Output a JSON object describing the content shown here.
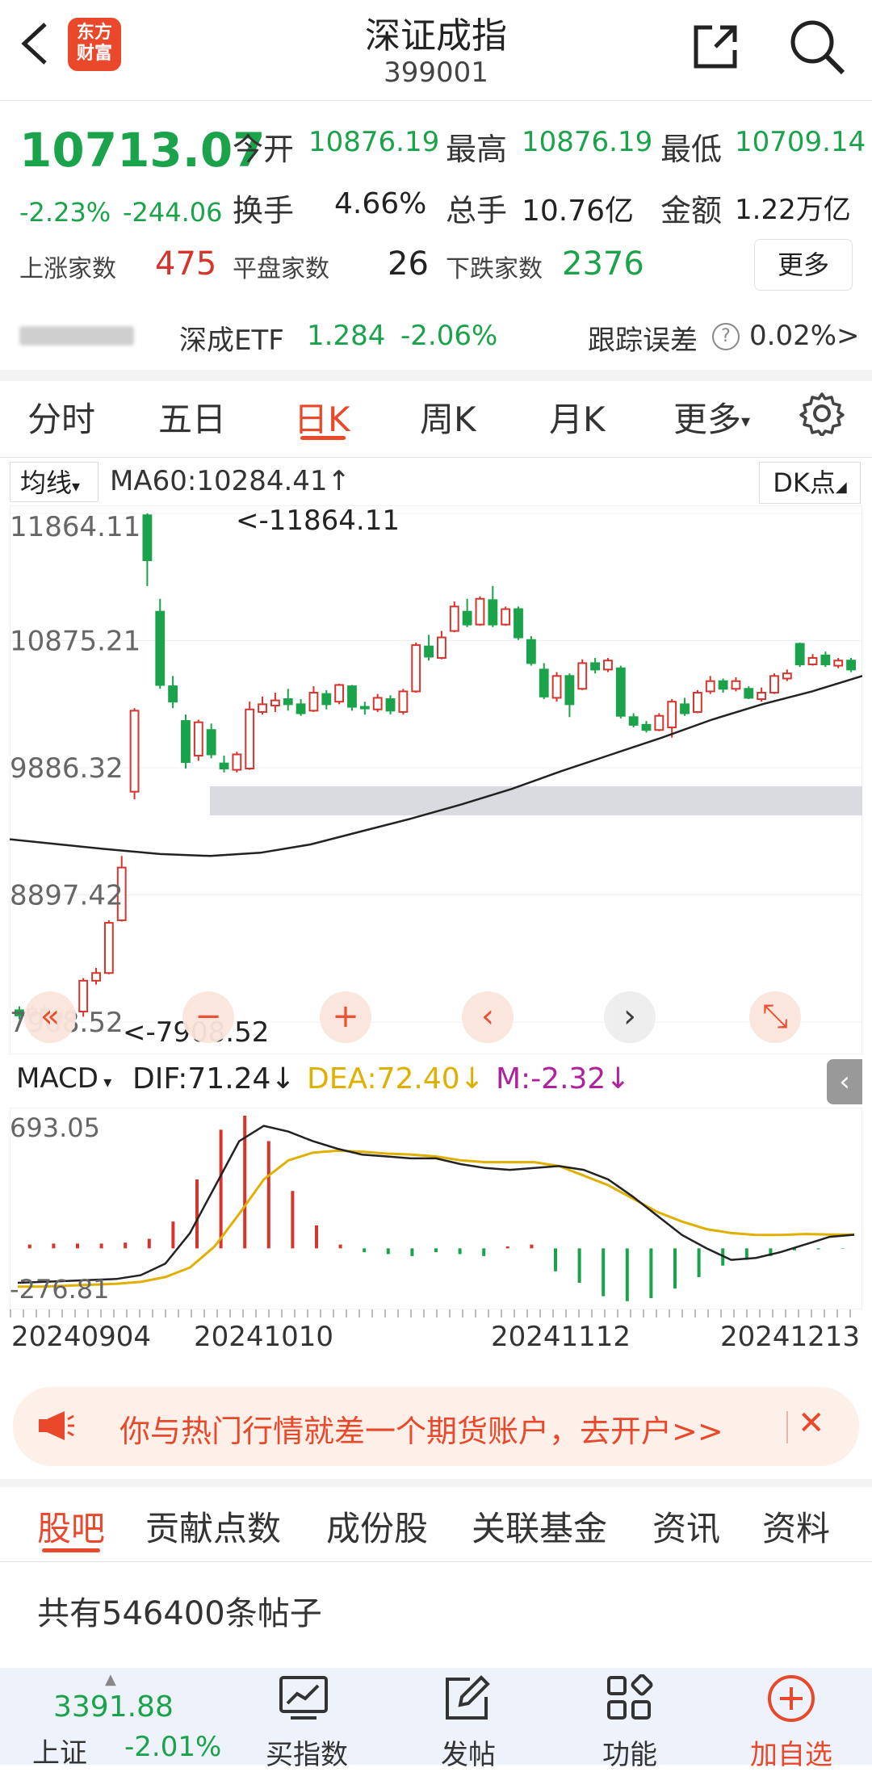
{
  "header": {
    "logo_line1": "东方",
    "logo_line2": "财富",
    "title": "深证成指",
    "code": "399001"
  },
  "quote": {
    "price": "10713.07",
    "change_pct": "-2.23%",
    "change": "-244.06",
    "open_label": "今开",
    "open": "10876.19",
    "high_label": "最高",
    "high": "10876.19",
    "low_label": "最低",
    "low": "10709.14",
    "turnover_label": "换手",
    "turnover": "4.66%",
    "volume_label": "总手",
    "volume": "10.76亿",
    "amount_label": "金额",
    "amount": "1.22万亿",
    "up_label": "上涨家数",
    "up_count": "475",
    "flat_label": "平盘家数",
    "flat_count": "26",
    "down_label": "下跌家数",
    "down_count": "2376",
    "more_label": "更多"
  },
  "etf": {
    "name": "深成ETF",
    "price": "1.284",
    "change": "-2.06%",
    "tracking_label": "跟踪误差",
    "tracking_value": "0.02%",
    "arrow": ">"
  },
  "tabs": [
    "分时",
    "五日",
    "日K",
    "周K",
    "月K",
    "更多"
  ],
  "active_tab": "日K",
  "chart_bar": {
    "ma_selector": "均线",
    "ma_text": "MA60:10284.41",
    "ma_arrow": "↑",
    "dk_label": "DK点"
  },
  "chart_data": {
    "type": "candlestick",
    "y_ticks": [
      "11864.11",
      "10875.21",
      "9886.32",
      "8897.42",
      "7908.52"
    ],
    "max_label": "<-11864.11",
    "min_label": "<-7908.52",
    "ylim": [
      7908.52,
      11864.11
    ],
    "x_ticks": [
      "20240904",
      "20241010",
      "20241112",
      "20241213"
    ],
    "ma60": [
      9330,
      9290,
      9250,
      9215,
      9200,
      9225,
      9290,
      9390,
      9490,
      9600,
      9720,
      9860,
      9990,
      10120,
      10260,
      10380,
      10480,
      10600
    ],
    "candles": [
      {
        "o": 8000,
        "c": 7960,
        "h": 8030,
        "l": 7930
      },
      {
        "o": 7960,
        "c": 8010,
        "h": 8040,
        "l": 7940
      },
      {
        "o": 8010,
        "c": 7975,
        "h": 8040,
        "l": 7950
      },
      {
        "o": 7975,
        "c": 7940,
        "h": 7990,
        "l": 7915
      },
      {
        "o": 7940,
        "c": 7990,
        "h": 8010,
        "l": 7920
      },
      {
        "o": 7990,
        "c": 8230,
        "h": 8250,
        "l": 7950
      },
      {
        "o": 8230,
        "c": 8290,
        "h": 8330,
        "l": 8200
      },
      {
        "o": 8290,
        "c": 8680,
        "h": 8700,
        "l": 8280
      },
      {
        "o": 8700,
        "c": 9110,
        "h": 9200,
        "l": 8690
      },
      {
        "o": 9700,
        "c": 10330,
        "h": 10350,
        "l": 9640
      },
      {
        "o": 11850,
        "c": 11500,
        "h": 11864,
        "l": 11300
      },
      {
        "o": 11100,
        "c": 10530,
        "h": 11200,
        "l": 10500
      },
      {
        "o": 10520,
        "c": 10400,
        "h": 10600,
        "l": 10350
      },
      {
        "o": 10250,
        "c": 9930,
        "h": 10300,
        "l": 9880
      },
      {
        "o": 9980,
        "c": 10240,
        "h": 10260,
        "l": 9940
      },
      {
        "o": 10180,
        "c": 9990,
        "h": 10230,
        "l": 9960
      },
      {
        "o": 9920,
        "c": 9880,
        "h": 9980,
        "l": 9850
      },
      {
        "o": 9870,
        "c": 9990,
        "h": 10010,
        "l": 9850
      },
      {
        "o": 9880,
        "c": 10340,
        "h": 10400,
        "l": 9870
      },
      {
        "o": 10320,
        "c": 10380,
        "h": 10440,
        "l": 10300
      },
      {
        "o": 10370,
        "c": 10410,
        "h": 10470,
        "l": 10320
      },
      {
        "o": 10420,
        "c": 10380,
        "h": 10500,
        "l": 10330
      },
      {
        "o": 10380,
        "c": 10310,
        "h": 10420,
        "l": 10290
      },
      {
        "o": 10330,
        "c": 10470,
        "h": 10520,
        "l": 10320
      },
      {
        "o": 10460,
        "c": 10380,
        "h": 10490,
        "l": 10340
      },
      {
        "o": 10400,
        "c": 10530,
        "h": 10540,
        "l": 10380
      },
      {
        "o": 10520,
        "c": 10360,
        "h": 10530,
        "l": 10330
      },
      {
        "o": 10360,
        "c": 10350,
        "h": 10400,
        "l": 10300
      },
      {
        "o": 10340,
        "c": 10430,
        "h": 10460,
        "l": 10320
      },
      {
        "o": 10420,
        "c": 10330,
        "h": 10450,
        "l": 10300
      },
      {
        "o": 10320,
        "c": 10480,
        "h": 10500,
        "l": 10300
      },
      {
        "o": 10480,
        "c": 10840,
        "h": 10860,
        "l": 10470
      },
      {
        "o": 10830,
        "c": 10750,
        "h": 10920,
        "l": 10720
      },
      {
        "o": 10740,
        "c": 10900,
        "h": 10950,
        "l": 10730
      },
      {
        "o": 10950,
        "c": 11140,
        "h": 11180,
        "l": 10940
      },
      {
        "o": 11100,
        "c": 11000,
        "h": 11200,
        "l": 10980
      },
      {
        "o": 11000,
        "c": 11200,
        "h": 11220,
        "l": 10990
      },
      {
        "o": 11190,
        "c": 11000,
        "h": 11300,
        "l": 10980
      },
      {
        "o": 11000,
        "c": 11120,
        "h": 11140,
        "l": 10990
      },
      {
        "o": 11120,
        "c": 10900,
        "h": 11140,
        "l": 10880
      },
      {
        "o": 10880,
        "c": 10700,
        "h": 10910,
        "l": 10680
      },
      {
        "o": 10650,
        "c": 10440,
        "h": 10700,
        "l": 10420
      },
      {
        "o": 10430,
        "c": 10600,
        "h": 10630,
        "l": 10400
      },
      {
        "o": 10600,
        "c": 10380,
        "h": 10620,
        "l": 10280
      },
      {
        "o": 10500,
        "c": 10700,
        "h": 10730,
        "l": 10490
      },
      {
        "o": 10700,
        "c": 10650,
        "h": 10740,
        "l": 10620
      },
      {
        "o": 10650,
        "c": 10720,
        "h": 10740,
        "l": 10630
      },
      {
        "o": 10660,
        "c": 10290,
        "h": 10680,
        "l": 10270
      },
      {
        "o": 10280,
        "c": 10220,
        "h": 10310,
        "l": 10200
      },
      {
        "o": 10220,
        "c": 10180,
        "h": 10250,
        "l": 10160
      },
      {
        "o": 10180,
        "c": 10290,
        "h": 10310,
        "l": 10170
      },
      {
        "o": 10200,
        "c": 10400,
        "h": 10420,
        "l": 10120
      },
      {
        "o": 10380,
        "c": 10310,
        "h": 10430,
        "l": 10290
      },
      {
        "o": 10320,
        "c": 10470,
        "h": 10490,
        "l": 10310
      },
      {
        "o": 10480,
        "c": 10560,
        "h": 10600,
        "l": 10460
      },
      {
        "o": 10560,
        "c": 10500,
        "h": 10580,
        "l": 10470
      },
      {
        "o": 10500,
        "c": 10560,
        "h": 10590,
        "l": 10480
      },
      {
        "o": 10500,
        "c": 10430,
        "h": 10520,
        "l": 10420
      },
      {
        "o": 10420,
        "c": 10470,
        "h": 10510,
        "l": 10400
      },
      {
        "o": 10470,
        "c": 10600,
        "h": 10620,
        "l": 10460
      },
      {
        "o": 10580,
        "c": 10620,
        "h": 10650,
        "l": 10560
      },
      {
        "o": 10850,
        "c": 10690,
        "h": 10860,
        "l": 10670
      },
      {
        "o": 10690,
        "c": 10740,
        "h": 10770,
        "l": 10680
      },
      {
        "o": 10760,
        "c": 10690,
        "h": 10790,
        "l": 10670
      },
      {
        "o": 10680,
        "c": 10720,
        "h": 10740,
        "l": 10660
      },
      {
        "o": 10720,
        "c": 10650,
        "h": 10740,
        "l": 10630
      }
    ],
    "macd": {
      "label": "MACD",
      "dif_label": "DIF:71.24",
      "dea_label": "DEA:72.40",
      "m_label": "M:-2.32",
      "arrow": "↓",
      "y_ticks": [
        "693.05",
        "-276.81"
      ],
      "ylim": [
        -276.81,
        693.05
      ],
      "dif": [
        -180,
        -175,
        -170,
        -165,
        -160,
        -140,
        -80,
        80,
        320,
        560,
        640,
        610,
        560,
        520,
        490,
        480,
        470,
        470,
        440,
        420,
        410,
        420,
        430,
        410,
        360,
        270,
        170,
        70,
        0,
        -60,
        -50,
        -20,
        20,
        60,
        71
      ],
      "dea": [
        -200,
        -200,
        -195,
        -190,
        -185,
        -175,
        -150,
        -100,
        10,
        180,
        360,
        460,
        500,
        510,
        505,
        495,
        490,
        480,
        460,
        450,
        450,
        450,
        430,
        380,
        330,
        260,
        190,
        140,
        100,
        80,
        70,
        70,
        75,
        72,
        72
      ],
      "hist": [
        20,
        25,
        25,
        25,
        30,
        50,
        140,
        360,
        620,
        693,
        560,
        300,
        120,
        20,
        -20,
        -30,
        -40,
        -20,
        -30,
        -40,
        10,
        20,
        -120,
        -180,
        -250,
        -276,
        -260,
        -210,
        -150,
        -90,
        -60,
        -40,
        -10,
        -5,
        -2
      ]
    }
  },
  "chart_controls": [
    "«",
    "−",
    "+",
    "‹",
    "›",
    "⤡"
  ],
  "promo": {
    "text": "你与热门行情就差一个期货账户，去开户>>",
    "close": "✕"
  },
  "bottom_tabs": [
    "股吧",
    "贡献点数",
    "成份股",
    "关联基金",
    "资讯",
    "资料"
  ],
  "active_bottom_tab": "股吧",
  "posts_text": "共有546400条帖子",
  "bottom_nav": {
    "index_value": "3391.88",
    "index_name": "上证",
    "index_change": "-2.01%",
    "items": [
      "买指数",
      "发帖",
      "功能",
      "加自选"
    ]
  },
  "colors": {
    "up": "#d6342c",
    "down": "#1aa34a",
    "accent": "#e9482b",
    "dea": "#e0b000",
    "m": "#b0209f"
  }
}
